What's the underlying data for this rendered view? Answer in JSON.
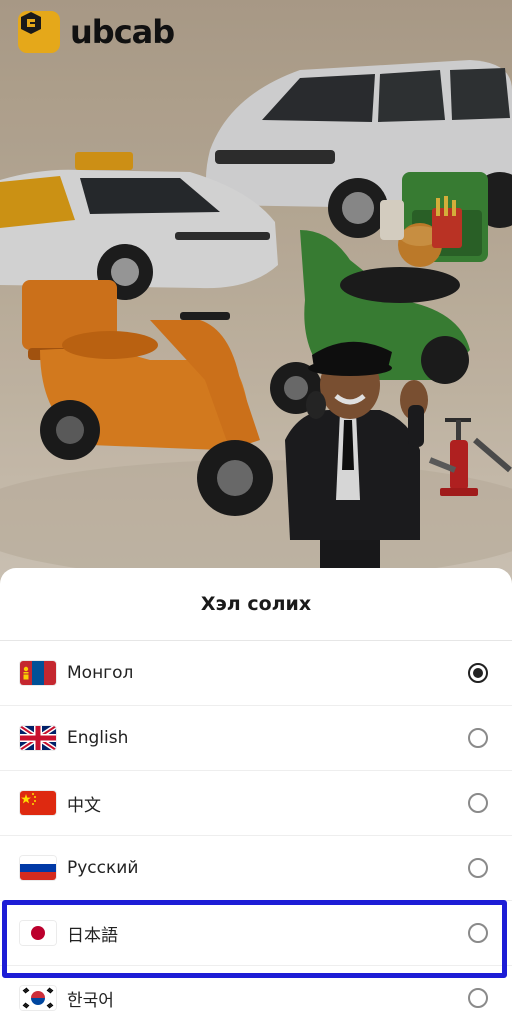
{
  "app": {
    "brand": "ubcab"
  },
  "hero": {
    "alt": ""
  },
  "sheet": {
    "title": "Хэл солих",
    "languages": [
      {
        "label": "Монгол",
        "flag": "mongolia-flag-icon",
        "selected": true
      },
      {
        "label": "English",
        "flag": "uk-flag-icon",
        "selected": false
      },
      {
        "label": "中文",
        "flag": "china-flag-icon",
        "selected": false
      },
      {
        "label": "Русский",
        "flag": "russia-flag-icon",
        "selected": false
      },
      {
        "label": "日本語",
        "flag": "japan-flag-icon",
        "selected": false
      },
      {
        "label": "한국어",
        "flag": "korea-flag-icon",
        "selected": false
      }
    ]
  },
  "colors": {
    "brand_yellow": "#e5a81a",
    "highlight_blue": "#1d1dd6",
    "scooter_orange": "#e8801e",
    "scooter_green": "#3f8d3a"
  }
}
